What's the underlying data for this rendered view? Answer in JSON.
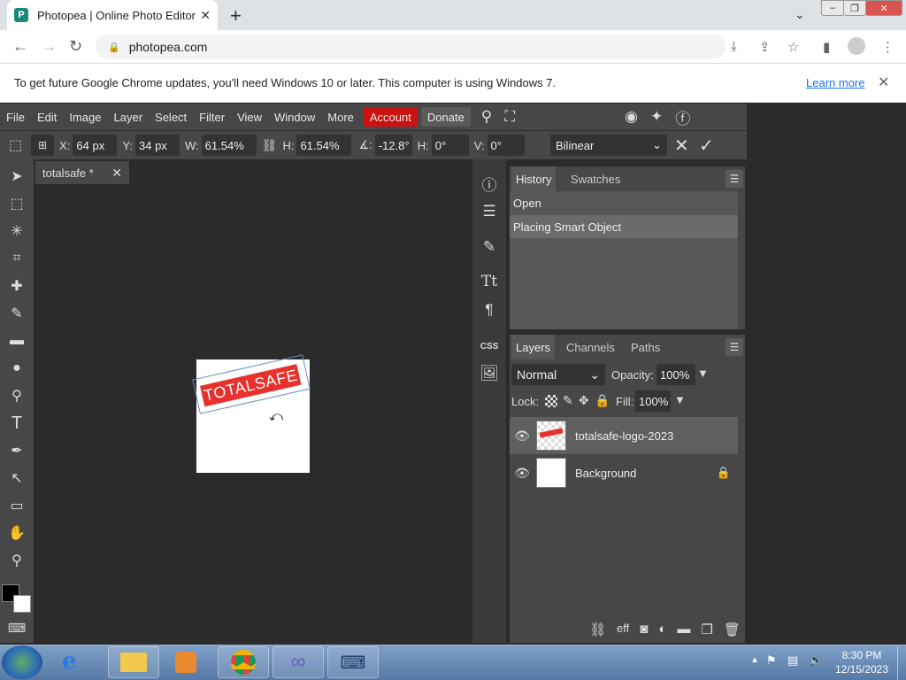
{
  "browser": {
    "tab_title": "Photopea | Online Photo Editor",
    "url": "photopea.com",
    "update_message": "To get future Google Chrome updates, you'll need Windows 10 or later. This computer is using Windows 7.",
    "learn_more": "Learn more"
  },
  "menu": [
    "File",
    "Edit",
    "Image",
    "Layer",
    "Select",
    "Filter",
    "View",
    "Window",
    "More"
  ],
  "account_label": "Account",
  "donate_label": "Donate",
  "options": {
    "x_label": "X:",
    "x_value": "64 px",
    "y_label": "Y:",
    "y_value": "34 px",
    "w_label": "W:",
    "w_value": "61.54%",
    "h_label": "H:",
    "h_value": "61.54%",
    "angle_value": "-12.8°",
    "hskew_label": "H:",
    "hskew_value": "0°",
    "vskew_label": "V:",
    "vskew_value": "0°",
    "interpolation": "Bilinear"
  },
  "document": {
    "tab_label": "totalsafe *",
    "logo_text": "TOTALSAFE"
  },
  "history": {
    "tabs": [
      "History",
      "Swatches"
    ],
    "items": [
      "Open",
      "Placing Smart Object"
    ]
  },
  "layers": {
    "tabs": [
      "Layers",
      "Channels",
      "Paths"
    ],
    "blend_mode": "Normal",
    "opacity_label": "Opacity:",
    "opacity_value": "100%",
    "lock_label": "Lock:",
    "fill_label": "Fill:",
    "fill_value": "100%",
    "items": [
      {
        "name": "totalsafe-logo-2023"
      },
      {
        "name": "Background"
      }
    ]
  },
  "clock": {
    "time": "8:30 PM",
    "date": "12/15/2023"
  },
  "colors": {
    "account": "#cc1111",
    "panel": "#474747",
    "canvas": "#2b2b2b"
  }
}
